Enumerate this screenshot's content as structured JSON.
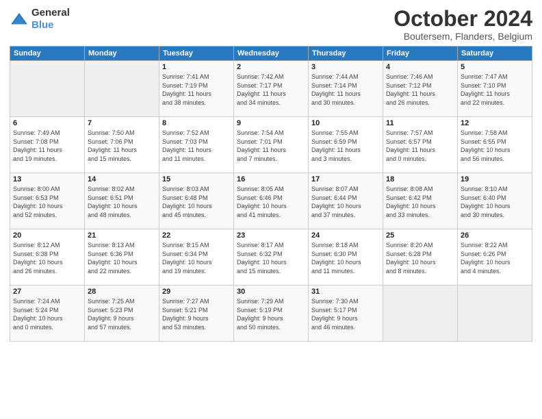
{
  "header": {
    "logo_general": "General",
    "logo_blue": "Blue",
    "month_title": "October 2024",
    "location": "Boutersem, Flanders, Belgium"
  },
  "weekdays": [
    "Sunday",
    "Monday",
    "Tuesday",
    "Wednesday",
    "Thursday",
    "Friday",
    "Saturday"
  ],
  "weeks": [
    [
      {
        "day": "",
        "detail": ""
      },
      {
        "day": "",
        "detail": ""
      },
      {
        "day": "1",
        "detail": "Sunrise: 7:41 AM\nSunset: 7:19 PM\nDaylight: 11 hours\nand 38 minutes."
      },
      {
        "day": "2",
        "detail": "Sunrise: 7:42 AM\nSunset: 7:17 PM\nDaylight: 11 hours\nand 34 minutes."
      },
      {
        "day": "3",
        "detail": "Sunrise: 7:44 AM\nSunset: 7:14 PM\nDaylight: 11 hours\nand 30 minutes."
      },
      {
        "day": "4",
        "detail": "Sunrise: 7:46 AM\nSunset: 7:12 PM\nDaylight: 11 hours\nand 26 minutes."
      },
      {
        "day": "5",
        "detail": "Sunrise: 7:47 AM\nSunset: 7:10 PM\nDaylight: 11 hours\nand 22 minutes."
      }
    ],
    [
      {
        "day": "6",
        "detail": "Sunrise: 7:49 AM\nSunset: 7:08 PM\nDaylight: 11 hours\nand 19 minutes."
      },
      {
        "day": "7",
        "detail": "Sunrise: 7:50 AM\nSunset: 7:06 PM\nDaylight: 11 hours\nand 15 minutes."
      },
      {
        "day": "8",
        "detail": "Sunrise: 7:52 AM\nSunset: 7:03 PM\nDaylight: 11 hours\nand 11 minutes."
      },
      {
        "day": "9",
        "detail": "Sunrise: 7:54 AM\nSunset: 7:01 PM\nDaylight: 11 hours\nand 7 minutes."
      },
      {
        "day": "10",
        "detail": "Sunrise: 7:55 AM\nSunset: 6:59 PM\nDaylight: 11 hours\nand 3 minutes."
      },
      {
        "day": "11",
        "detail": "Sunrise: 7:57 AM\nSunset: 6:57 PM\nDaylight: 11 hours\nand 0 minutes."
      },
      {
        "day": "12",
        "detail": "Sunrise: 7:58 AM\nSunset: 6:55 PM\nDaylight: 10 hours\nand 56 minutes."
      }
    ],
    [
      {
        "day": "13",
        "detail": "Sunrise: 8:00 AM\nSunset: 6:53 PM\nDaylight: 10 hours\nand 52 minutes."
      },
      {
        "day": "14",
        "detail": "Sunrise: 8:02 AM\nSunset: 6:51 PM\nDaylight: 10 hours\nand 48 minutes."
      },
      {
        "day": "15",
        "detail": "Sunrise: 8:03 AM\nSunset: 6:48 PM\nDaylight: 10 hours\nand 45 minutes."
      },
      {
        "day": "16",
        "detail": "Sunrise: 8:05 AM\nSunset: 6:46 PM\nDaylight: 10 hours\nand 41 minutes."
      },
      {
        "day": "17",
        "detail": "Sunrise: 8:07 AM\nSunset: 6:44 PM\nDaylight: 10 hours\nand 37 minutes."
      },
      {
        "day": "18",
        "detail": "Sunrise: 8:08 AM\nSunset: 6:42 PM\nDaylight: 10 hours\nand 33 minutes."
      },
      {
        "day": "19",
        "detail": "Sunrise: 8:10 AM\nSunset: 6:40 PM\nDaylight: 10 hours\nand 30 minutes."
      }
    ],
    [
      {
        "day": "20",
        "detail": "Sunrise: 8:12 AM\nSunset: 6:38 PM\nDaylight: 10 hours\nand 26 minutes."
      },
      {
        "day": "21",
        "detail": "Sunrise: 8:13 AM\nSunset: 6:36 PM\nDaylight: 10 hours\nand 22 minutes."
      },
      {
        "day": "22",
        "detail": "Sunrise: 8:15 AM\nSunset: 6:34 PM\nDaylight: 10 hours\nand 19 minutes."
      },
      {
        "day": "23",
        "detail": "Sunrise: 8:17 AM\nSunset: 6:32 PM\nDaylight: 10 hours\nand 15 minutes."
      },
      {
        "day": "24",
        "detail": "Sunrise: 8:18 AM\nSunset: 6:30 PM\nDaylight: 10 hours\nand 11 minutes."
      },
      {
        "day": "25",
        "detail": "Sunrise: 8:20 AM\nSunset: 6:28 PM\nDaylight: 10 hours\nand 8 minutes."
      },
      {
        "day": "26",
        "detail": "Sunrise: 8:22 AM\nSunset: 6:26 PM\nDaylight: 10 hours\nand 4 minutes."
      }
    ],
    [
      {
        "day": "27",
        "detail": "Sunrise: 7:24 AM\nSunset: 5:24 PM\nDaylight: 10 hours\nand 0 minutes."
      },
      {
        "day": "28",
        "detail": "Sunrise: 7:25 AM\nSunset: 5:23 PM\nDaylight: 9 hours\nand 57 minutes."
      },
      {
        "day": "29",
        "detail": "Sunrise: 7:27 AM\nSunset: 5:21 PM\nDaylight: 9 hours\nand 53 minutes."
      },
      {
        "day": "30",
        "detail": "Sunrise: 7:29 AM\nSunset: 5:19 PM\nDaylight: 9 hours\nand 50 minutes."
      },
      {
        "day": "31",
        "detail": "Sunrise: 7:30 AM\nSunset: 5:17 PM\nDaylight: 9 hours\nand 46 minutes."
      },
      {
        "day": "",
        "detail": ""
      },
      {
        "day": "",
        "detail": ""
      }
    ]
  ]
}
